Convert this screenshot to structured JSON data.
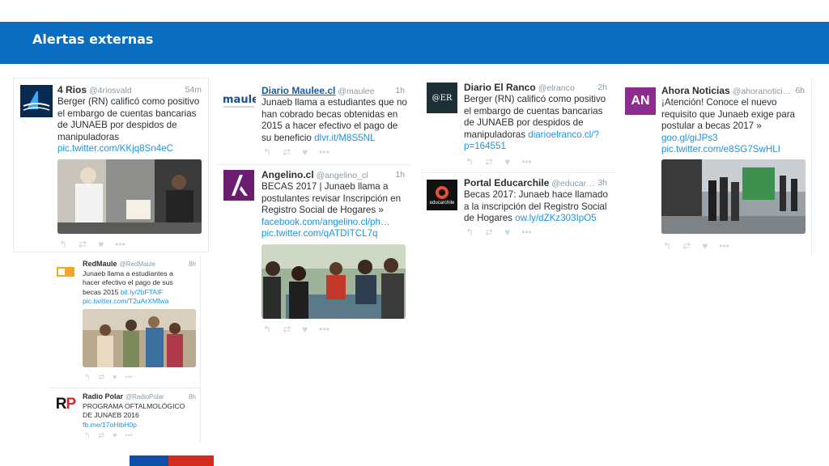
{
  "header": {
    "title": "Alertas externas"
  },
  "tweets": {
    "rios": {
      "name": "4 Rios",
      "handle": "@4riosvald",
      "time": "54m",
      "lines": [
        "Berger (RN) calificó como positivo",
        "el embargo de cuentas bancarias",
        "de JUNAEB por despidos de",
        "manipuladoras"
      ],
      "link": "pic.twitter.com/KKjq8Sn4eC",
      "avatar_text": "4rios"
    },
    "maulee": {
      "name": "Diario Maulee.cl",
      "handle": "@maulee",
      "time": "1h",
      "lines": [
        "Junaeb llama a estudiantes que no",
        "han cobrado becas obtenidas en",
        "2015 a hacer efectivo el pago de"
      ],
      "last_prefix": "su beneficio ",
      "link": "dlvr.it/M8S5NL",
      "avatar_text": "maulee"
    },
    "angelino": {
      "name": "Angelino.cl",
      "handle": "@angelino_cl",
      "time": "1h",
      "lines": [
        "BECAS 2017 | Junaeb llama a",
        "postulantes revisar Inscripción en",
        "Registro Social de Hogares »"
      ],
      "links": [
        "facebook.com/angelino.cl/ph…",
        "pic.twitter.com/qATDITCL7q"
      ],
      "avatar_text": "A"
    },
    "elranco": {
      "name": "Diario El Ranco",
      "handle": "@elranco",
      "time": "2h",
      "lines": [
        "Berger (RN) calificó como positivo",
        "el embargo de cuentas bancarias",
        "de JUNAEB por despidos de"
      ],
      "last_prefix": "manipuladoras ",
      "link": "diarioelranco.cl/?",
      "link2": "p=164551",
      "avatar_text": "@ER"
    },
    "educarchile": {
      "name": "Portal Educarchile",
      "handle": "@educar…",
      "time": "3h",
      "lines": [
        "Becas 2017: Junaeb hace llamado",
        "a la inscripción del Registro Social"
      ],
      "last_prefix": "de Hogares ",
      "link": "ow.ly/dZKz303IpO5",
      "avatar_text": "educarchile"
    },
    "ahora": {
      "name": "Ahora Noticias",
      "handle": "@ahoranotici…",
      "time": "6h",
      "lines": [
        "¡Atención! Conoce el nuevo",
        "requisito que Junaeb exige para",
        "postular a becas 2017 »"
      ],
      "links": [
        "goo.gl/giJPs3",
        "pic.twitter.com/e8SG7SwHLI"
      ],
      "avatar_text": "AN"
    },
    "redmaule": {
      "name": "RedMaule",
      "handle": "@RedMaule",
      "time": "8h",
      "lines": [
        "Junaeb llama a estudiantes a",
        "hacer efectivo el pago de sus"
      ],
      "last_prefix": "becas 2015 ",
      "link": "bit.ly/2bFTAIF",
      "link2": "pic.twitter.com/T2uArXMfwa"
    },
    "radiopolar": {
      "name": "Radio Polar",
      "handle": "@RadioPolar",
      "time": "8h",
      "lines": [
        "PROGRAMA OFTALMOLÓGICO",
        "DE JUNAEB 2016"
      ],
      "link": "fb.me/17oHibH0p",
      "avatar_text": "RP"
    }
  },
  "actions": {
    "reply": "↰",
    "retweet": "⇄",
    "like": "♥",
    "more": "•••"
  },
  "colors": {
    "header": "#0b6dc0",
    "link": "#1b95e0",
    "footer_blue": "#0b4fa8",
    "footer_red": "#d52b1e"
  }
}
